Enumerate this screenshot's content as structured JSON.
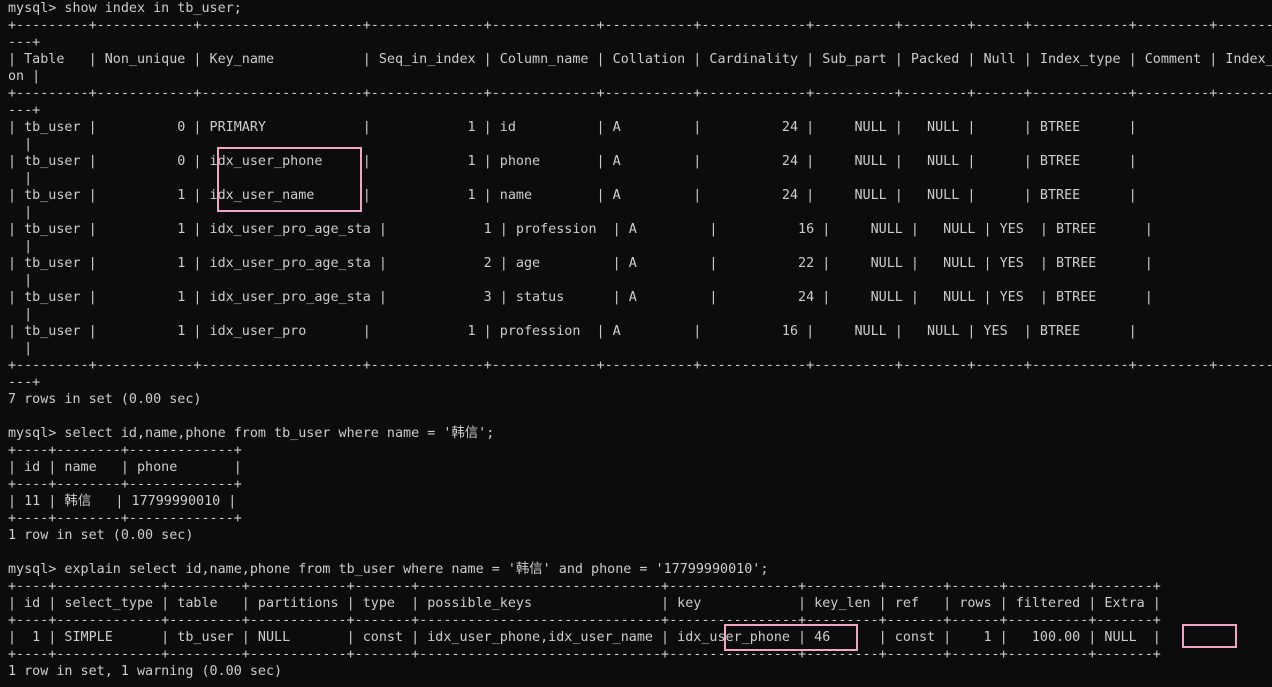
{
  "terminal": {
    "lines": [
      "mysql> show index in tb_user;",
      "+---------+------------+--------------------+--------------+-------------+-----------+-------------+----------+--------+------+------------+---------+---------------+---------+------------+",
      "---+",
      "| Table   | Non_unique | Key_name           | Seq_in_index | Column_name | Collation | Cardinality | Sub_part | Packed | Null | Index_type | Comment | Index_comment | Visible | Expressi",
      "on |",
      "+---------+------------+--------------------+--------------+-------------+-----------+-------------+----------+--------+------+------------+---------+---------------+---------+------------+",
      "---+",
      "| tb_user |          0 | PRIMARY            |            1 | id          | A         |          24 |     NULL |   NULL |      | BTREE      |",
      "  |",
      "| tb_user |          0 | idx_user_phone     |            1 | phone       | A         |          24 |     NULL |   NULL |      | BTREE      |",
      "  |",
      "| tb_user |          1 | idx_user_name      |            1 | name        | A         |          24 |     NULL |   NULL |      | BTREE      |",
      "  |",
      "| tb_user |          1 | idx_user_pro_age_sta |            1 | profession  | A         |          16 |     NULL |   NULL | YES  | BTREE      |",
      "  |",
      "| tb_user |          1 | idx_user_pro_age_sta |            2 | age         | A         |          22 |     NULL |   NULL | YES  | BTREE      |",
      "  |",
      "| tb_user |          1 | idx_user_pro_age_sta |            3 | status      | A         |          24 |     NULL |   NULL | YES  | BTREE      |",
      "  |",
      "| tb_user |          1 | idx_user_pro       |            1 | profession  | A         |          16 |     NULL |   NULL | YES  | BTREE      |",
      "  |",
      "+---------+------------+--------------------+--------------+-------------+-----------+-------------+----------+--------+------+------------+---------+---------------+---------+------------+",
      "---+",
      "7 rows in set (0.00 sec)",
      "",
      "mysql> select id,name,phone from tb_user where name = '韩信';",
      "+----+--------+-------------+",
      "| id | name   | phone       |",
      "+----+--------+-------------+",
      "| 11 | 韩信   | 17799990010 |",
      "+----+--------+-------------+",
      "1 row in set (0.00 sec)",
      "",
      "mysql> explain select id,name,phone from tb_user where name = '韩信' and phone = '17799990010';",
      "+----+-------------+---------+------------+-------+------------------------------+----------------+---------+-------+------+----------+-------+",
      "| id | select_type | table   | partitions | type  | possible_keys                | key            | key_len | ref   | rows | filtered | Extra |",
      "+----+-------------+---------+------------+-------+------------------------------+----------------+---------+-------+------+----------+-------+",
      "|  1 | SIMPLE      | tb_user | NULL       | const | idx_user_phone,idx_user_name | idx_user_phone | 46      | const |    1 |   100.00 | NULL  |",
      "+----+-------------+---------+------------+-------+------------------------------+----------------+---------+-------+------+----------+-------+",
      "1 row in set, 1 warning (0.00 sec)"
    ]
  },
  "colors": {
    "background": "#0c0c0c",
    "text": "#cccccc",
    "highlight": "#f3a3c3"
  }
}
